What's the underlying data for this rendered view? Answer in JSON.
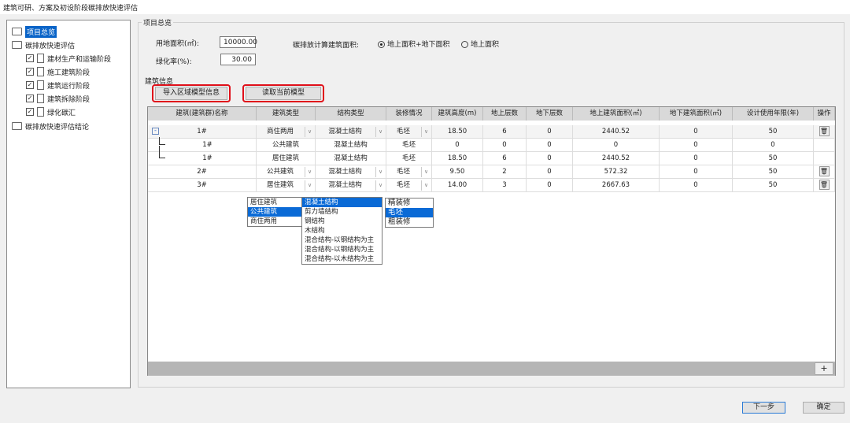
{
  "window": {
    "title": "建筑可研、方案及初设阶段碳排放快速评估"
  },
  "tree": [
    {
      "label": "项目总览",
      "type": "folder",
      "selected": true
    },
    {
      "label": "碳排放快速评估",
      "type": "folder"
    },
    {
      "label": "建材生产和运输阶段",
      "type": "doc",
      "checked": true
    },
    {
      "label": "施工建筑阶段",
      "type": "doc",
      "checked": true
    },
    {
      "label": "建筑运行阶段",
      "type": "doc",
      "checked": true
    },
    {
      "label": "建筑拆除阶段",
      "type": "doc",
      "checked": true
    },
    {
      "label": "绿化碳汇",
      "type": "doc",
      "checked": true
    },
    {
      "label": "碳排放快速评估结论",
      "type": "folder"
    }
  ],
  "overview": {
    "group_title": "项目总览",
    "land_area_label": "用地面积(㎡):",
    "land_area": "10000.00",
    "green_rate_label": "绿化率(%):",
    "green_rate": "30.00",
    "calc_area_label": "碳排放计算建筑面积:",
    "radio_options": [
      "地上面积+地下面积",
      "地上面积"
    ],
    "radio_selected": 0
  },
  "building": {
    "section_title": "建筑信息",
    "import_button": "导入区域模型信息",
    "read_button": "读取当前模型",
    "highlight_color": "#e0101a",
    "columns": [
      "建筑(建筑群)名称",
      "建筑类型",
      "结构类型",
      "装修情况",
      "建筑高度(m)",
      "地上层数",
      "地下层数",
      "地上建筑面积(㎡)",
      "地下建筑面积(㎡)",
      "设计使用年限(年)",
      "操作"
    ],
    "rows": [
      {
        "name": "1#",
        "type": "商住两用",
        "struct": "混凝土结构",
        "decor": "毛坯",
        "height": "18.50",
        "above": "6",
        "below": "0",
        "area": "2440.52",
        "under_area": "0",
        "years": "50",
        "level": 0,
        "expander": "⊟",
        "editable": true
      },
      {
        "name": "1#",
        "type": "公共建筑",
        "struct": "混凝土结构",
        "decor": "毛坯",
        "height": "0",
        "above": "0",
        "below": "0",
        "area": "0",
        "under_area": "0",
        "years": "0",
        "level": 1,
        "editable": false
      },
      {
        "name": "1#",
        "type": "居住建筑",
        "struct": "混凝土结构",
        "decor": "毛坯",
        "height": "18.50",
        "above": "6",
        "below": "0",
        "area": "2440.52",
        "under_area": "0",
        "years": "50",
        "level": 1,
        "editable": false
      },
      {
        "name": "2#",
        "type": "公共建筑",
        "struct": "混凝土结构",
        "decor": "毛坯",
        "height": "9.50",
        "above": "2",
        "below": "0",
        "area": "572.32",
        "under_area": "0",
        "years": "50",
        "level": 0,
        "editable": true
      },
      {
        "name": "3#",
        "type": "居住建筑",
        "struct": "混凝土结构",
        "decor": "毛坯",
        "height": "14.00",
        "above": "3",
        "below": "0",
        "area": "2667.63",
        "under_area": "0",
        "years": "50",
        "level": 0,
        "editable": true
      }
    ],
    "add_button": "+",
    "type_options": [
      "居住建筑",
      "公共建筑",
      "商住两用"
    ],
    "type_selected": 1,
    "struct_options": [
      "混凝土结构",
      "剪力墙结构",
      "钢结构",
      "木结构",
      "混合结构-以钢结构为主",
      "混合结构-以钢结构为主",
      "混合结构-以木结构为主"
    ],
    "struct_selected": 0,
    "decor_options": [
      "精装修",
      "毛坯",
      "粗装修"
    ],
    "decor_selected": 1
  },
  "footer": {
    "next_button": "下一步",
    "ok_button": "确定"
  }
}
